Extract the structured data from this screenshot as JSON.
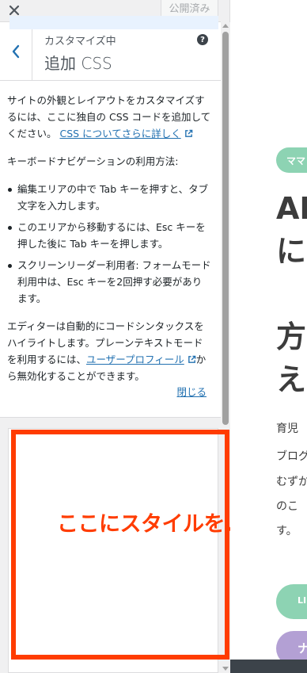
{
  "topbar": {
    "close_label": "×",
    "publish_label": "公開済み"
  },
  "section": {
    "subtitle": "カスタマイズ中",
    "title": "追加 CSS",
    "help_label": "?"
  },
  "description": {
    "intro_text": "サイトの外観とレイアウトをカスタマイズするには、ここに独自の CSS コードを追加してください。",
    "intro_link": "CSS についてさらに詳しく",
    "keyboard_heading": "キーボードナビゲーションの利用方法:",
    "keyboard_items": [
      "編集エリアの中で Tab キーを押すと、タブ文字を入力します。",
      "このエリアから移動するには、Esc キーを押した後に Tab キーを押します。",
      "スクリーンリーダー利用者: フォームモード利用中は、Esc キーを2回押す必要があります。"
    ],
    "syntax_text": "エディターは自動的にコードシンタックスをハイライトします。プレーンテキストモードを利用するには、",
    "profile_link": "ユーザープロフィール",
    "syntax_text_end": "から無効化することができます。",
    "close_link": "閉じる"
  },
  "annotation": {
    "label": "ここにスタイルを入力",
    "color": "#ff3c00"
  },
  "preview": {
    "category_pill": "ママ",
    "title_lines": [
      "AI",
      "に",
      "「",
      "方",
      "え"
    ],
    "body_lines": [
      "育児",
      "ブログ",
      "むずか",
      "のこ",
      "す。"
    ],
    "button1_label": "LI",
    "button2_label": "ナ",
    "accent_green": "#8dd3b3",
    "accent_purple": "#b3a0d4"
  },
  "colors": {
    "link": "#2271b1",
    "panel_bg": "#f0f0f1"
  }
}
